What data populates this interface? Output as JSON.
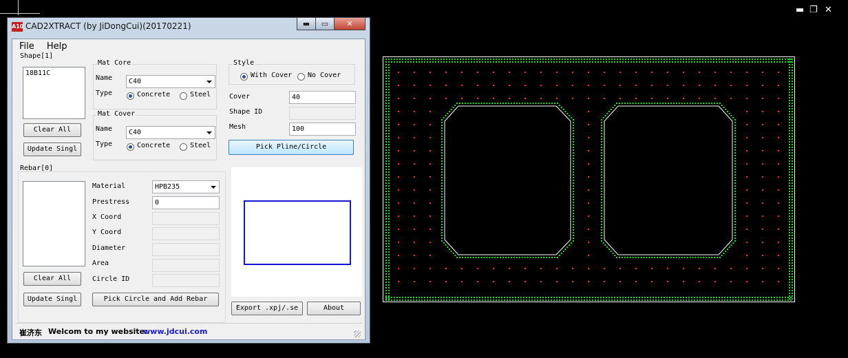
{
  "host": {
    "controls": {
      "minimize": "▬",
      "restore": "❐",
      "close": "✕"
    }
  },
  "window": {
    "title": "CAD2XTRACT (by JiDongCui)(20170221)",
    "logo_text": "A10",
    "buttons": {
      "minimize": "▬",
      "maximize": "▭",
      "close": "✕"
    }
  },
  "menu": {
    "file": "File",
    "help": "Help"
  },
  "shape": {
    "group_label": "Shape[1]",
    "items": [
      "18B11C"
    ],
    "clear_all": "Clear All",
    "update_single": "Update Singl"
  },
  "mat_core": {
    "title": "Mat Core",
    "name_label": "Name",
    "name_value": "C40",
    "type_label": "Type",
    "concrete": "Concrete",
    "steel": "Steel",
    "selected": "Concrete"
  },
  "mat_cover": {
    "title": "Mat Cover",
    "name_label": "Name",
    "name_value": "C40",
    "type_label": "Type",
    "concrete": "Concrete",
    "steel": "Steel",
    "selected": "Concrete"
  },
  "style": {
    "title": "Style",
    "with_cover": "With Cover",
    "no_cover": "No Cover",
    "selected": "With Cover"
  },
  "params": {
    "cover_label": "Cover",
    "cover_value": "40",
    "shape_id_label": "Shape ID",
    "shape_id_value": "",
    "mesh_label": "Mesh",
    "mesh_value": "100",
    "pick_button": "Pick Pline/Circle"
  },
  "rebar": {
    "group_label": "Rebar[0]",
    "material_label": "Material",
    "material_value": "HPB235",
    "prestress_label": "Prestress",
    "prestress_value": "0",
    "x_label": "X Coord",
    "y_label": "Y Coord",
    "diameter_label": "Diameter",
    "area_label": "Area",
    "circle_id_label": "Circle ID",
    "clear_all": "Clear All",
    "update_single": "Update Singl",
    "pick_button": "Pick Circle and Add Rebar"
  },
  "actions": {
    "export": "Export .xpj/.se",
    "about": "About"
  },
  "status": {
    "author_zh": "崔济东",
    "welcome": "Welcom to my website:",
    "url": "www.jdcui.com"
  },
  "colors": {
    "background": "#000000",
    "section_outline": "#ffffff",
    "cover_mesh": "#1fe01f",
    "core_mesh": "#ff2a2a",
    "preview_rect": "#1414d2",
    "link": "#1a1ad2"
  }
}
